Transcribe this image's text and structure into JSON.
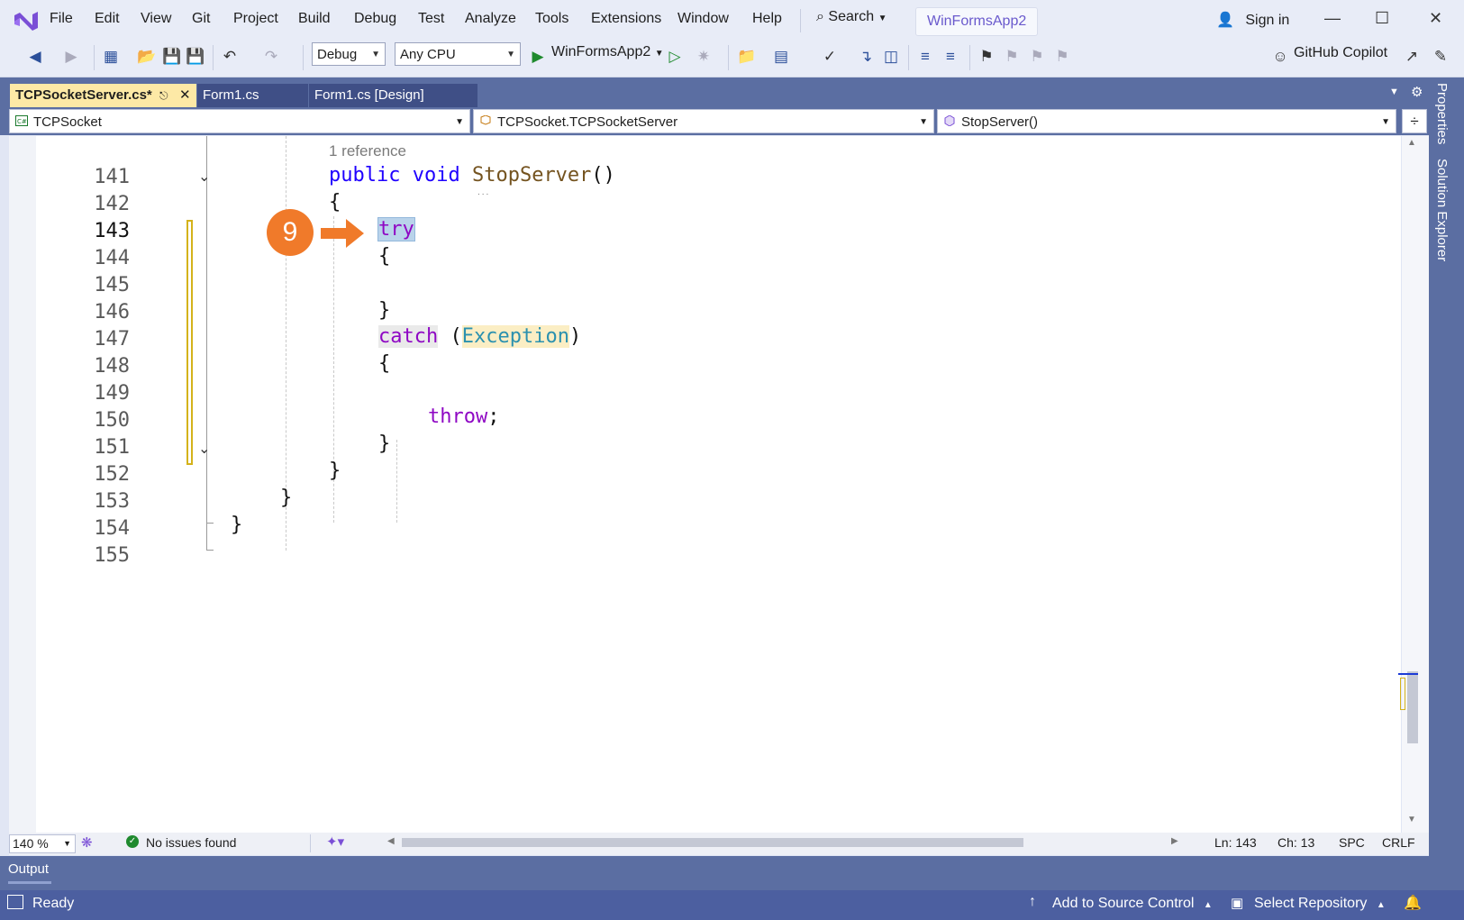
{
  "menu": {
    "items": [
      "File",
      "Edit",
      "View",
      "Git",
      "Project",
      "Build",
      "Debug",
      "Test",
      "Analyze",
      "Tools",
      "Extensions",
      "Window",
      "Help"
    ],
    "search_label": "Search",
    "solution_name": "WinFormsApp2",
    "signin_label": "Sign in"
  },
  "toolbar": {
    "config": "Debug",
    "platform": "Any CPU",
    "run_target": "WinFormsApp2",
    "copilot_label": "GitHub Copilot"
  },
  "tabs": [
    {
      "label": "TCPSocketServer.cs*"
    },
    {
      "label": "Form1.cs"
    },
    {
      "label": "Form1.cs [Design]"
    }
  ],
  "navbar": {
    "project": "TCPSocket",
    "type": "TCPSocket.TCPSocketServer",
    "member": "StopServer()"
  },
  "editor": {
    "codelens": "1 reference",
    "lines": [
      "141",
      "142",
      "143",
      "144",
      "145",
      "146",
      "147",
      "148",
      "149",
      "150",
      "151",
      "152",
      "153",
      "154",
      "155"
    ],
    "current_line": "143",
    "step_badge": "9"
  },
  "right_tabs": [
    "Properties",
    "Solution Explorer"
  ],
  "editor_status": {
    "zoom": "140 %",
    "issues": "No issues found",
    "ln": "Ln: 143",
    "ch": "Ch: 13",
    "spc": "SPC",
    "crlf": "CRLF"
  },
  "output_label": "Output",
  "statusbar": {
    "ready": "Ready",
    "source_control": "Add to Source Control",
    "repository": "Select Repository"
  },
  "colors": {
    "accent_orange": "#f07a2a",
    "keyword_blue": "#1f00ff",
    "keyword_purple": "#8f08c4",
    "type_teal": "#2b91af",
    "active_tab": "#fde9a6"
  }
}
